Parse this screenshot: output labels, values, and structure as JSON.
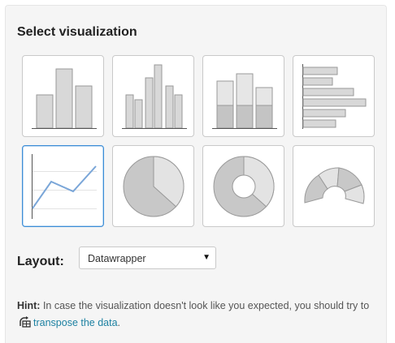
{
  "title": "Select visualization",
  "visualizations": [
    {
      "id": "bar-chart",
      "selected": false
    },
    {
      "id": "grouped-bar-chart",
      "selected": false
    },
    {
      "id": "stacked-bar-chart",
      "selected": false
    },
    {
      "id": "horizontal-bar-chart",
      "selected": false
    },
    {
      "id": "line-chart",
      "selected": true
    },
    {
      "id": "pie-chart",
      "selected": false
    },
    {
      "id": "donut-chart",
      "selected": false
    },
    {
      "id": "election-donut-chart",
      "selected": false
    }
  ],
  "layout": {
    "label": "Layout:",
    "selected": "Datawrapper",
    "caret": "▼"
  },
  "hint": {
    "prefix": "Hint:",
    "text": "In case the visualization doesn't look like you expected, you should try to",
    "link": "transpose the data",
    "suffix": "."
  },
  "colors": {
    "accent": "#3c8dd6",
    "link": "#1d81a2",
    "bar": "#d8d8d8",
    "line": "#7aa6d8"
  }
}
